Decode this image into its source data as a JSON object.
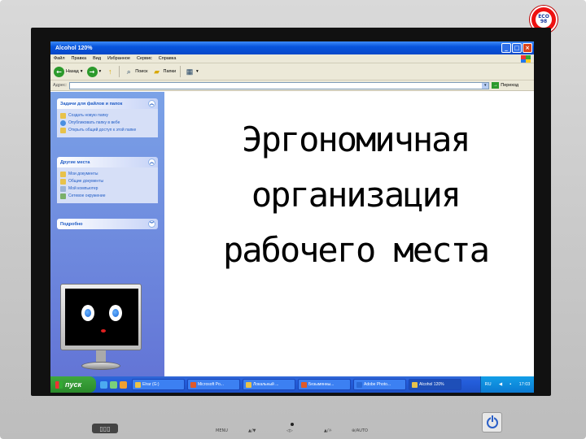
{
  "window": {
    "title": "Alcohol 120%",
    "controls": [
      "_",
      "□",
      "×"
    ]
  },
  "menu": [
    "Файл",
    "Правка",
    "Вид",
    "Избранное",
    "Сервис",
    "Справка"
  ],
  "toolbar": {
    "back": "Назад",
    "search": "Поиск",
    "folders": "Папки"
  },
  "address": {
    "label": "Адрес:",
    "value": "",
    "go": "Переход"
  },
  "taskpane": {
    "panels": [
      {
        "title": "Задачи для файлов и папок",
        "items": [
          "Создать новую папку",
          "Опубликовать папку в вебе",
          "Открыть общий доступ к этой папке"
        ]
      },
      {
        "title": "Другие места",
        "items": [
          "Мои документы",
          "Общие документы",
          "Мой компьютер",
          "Сетевое окружение"
        ]
      },
      {
        "title": "Подробно",
        "items": []
      }
    ]
  },
  "main": {
    "title_lines": [
      "Эргономичная",
      "организация",
      "рабочего места"
    ]
  },
  "taskbar": {
    "start": "пуск",
    "tasks": [
      "Elrar (G:)",
      "Microsoft Po...",
      "Локальный ...",
      "Безымянны...",
      "Adobe Photo...",
      "Alcohol 120%"
    ],
    "lang": "RU",
    "clock": "17:03"
  },
  "bezel": {
    "badge": "ЕСО 98",
    "controls": [
      "MENU",
      "▲/▼",
      "◁▷",
      "▲/☼",
      "⊕/AUTO"
    ]
  },
  "colors": {
    "titlebar": "#0855dd",
    "taskpane": "#6f8ee0",
    "taskbar": "#245edc",
    "start": "#2b8a2b",
    "main_text": "#000000"
  }
}
